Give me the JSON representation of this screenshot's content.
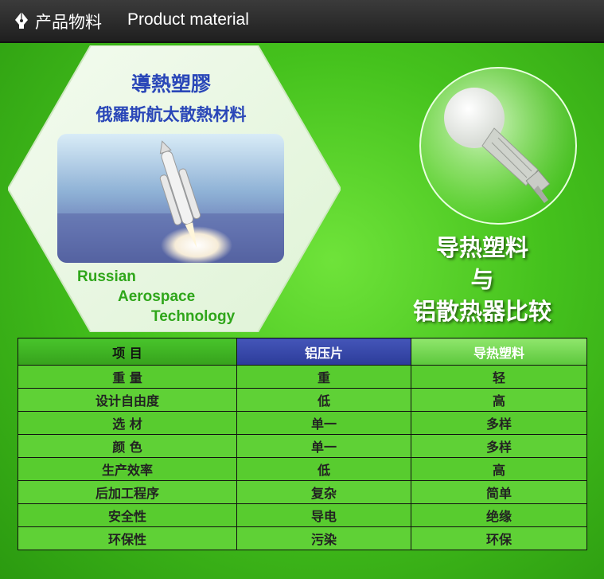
{
  "header": {
    "title_cn": "产品物料",
    "title_en": "Product material"
  },
  "hexagon": {
    "title_line1": "導熱塑膠",
    "title_line2": "俄羅斯航太散熱材料",
    "tech_line1": "Russian",
    "tech_line2": "Aerospace",
    "tech_line3": "Technology"
  },
  "comparison": {
    "line1": "导热塑料",
    "line2": "与",
    "line3": "铝散热器比较"
  },
  "table": {
    "headers": [
      "项  目",
      "铝压片",
      "导热塑料"
    ],
    "rows": [
      [
        "重  量",
        "重",
        "轻"
      ],
      [
        "设计自由度",
        "低",
        "高"
      ],
      [
        "选  材",
        "单一",
        "多样"
      ],
      [
        "颜  色",
        "单一",
        "多样"
      ],
      [
        "生产效率",
        "低",
        "高"
      ],
      [
        "后加工程序",
        "复杂",
        "简单"
      ],
      [
        "安全性",
        "导电",
        "绝缘"
      ],
      [
        "环保性",
        "污染",
        "环保"
      ]
    ]
  },
  "colors": {
    "blue_header": "#2c3c9a",
    "green_bg": "#45c21d",
    "title_blue": "#2a47b8"
  }
}
